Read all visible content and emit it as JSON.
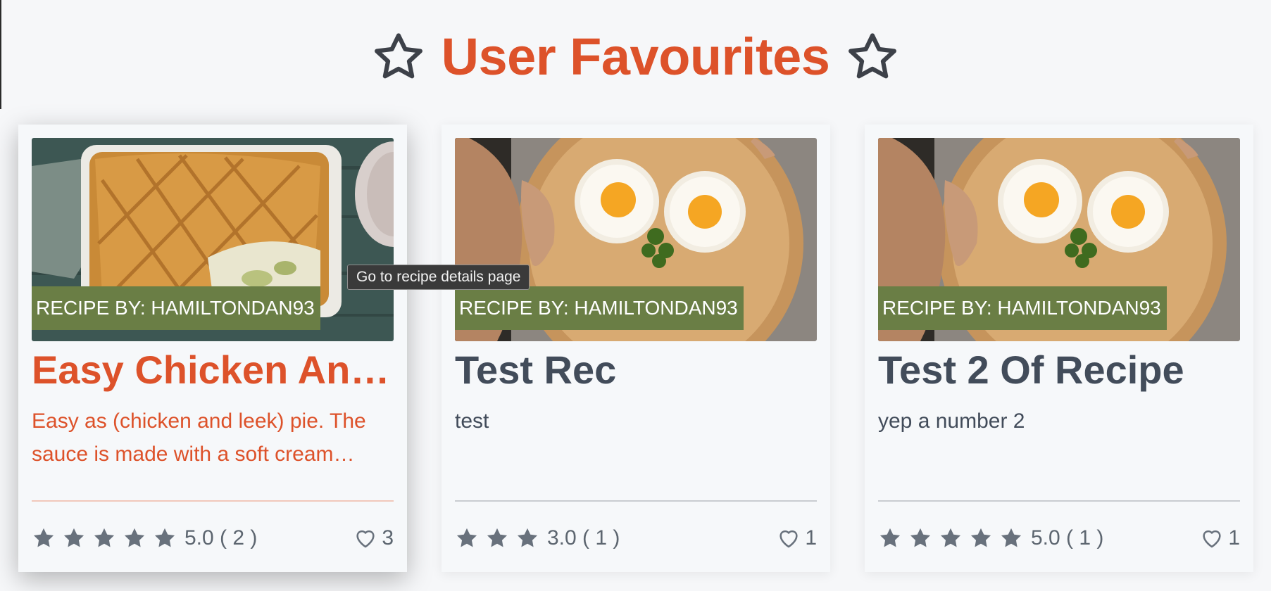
{
  "page": {
    "heading": "User Favourites",
    "accent_color": "#dd522a"
  },
  "tooltip": "Go to recipe details page",
  "recipes": [
    {
      "author_tag": "RECIPE BY: HAMILTONDAN93",
      "title": "Easy Chicken And…",
      "description": "Easy as (chicken and leek) pie. The sauce is made with a soft cream…",
      "stars": 5,
      "rating_label": "5.0 ( 2 )",
      "likes": "3",
      "image": "chicken-leek-pie-photo",
      "hovered": true
    },
    {
      "author_tag": "RECIPE BY: HAMILTONDAN93",
      "title": "Test Rec",
      "description": "test",
      "stars": 3,
      "rating_label": "3.0 ( 1 )",
      "likes": "1",
      "image": "fried-eggs-plate-photo",
      "hovered": false
    },
    {
      "author_tag": "RECIPE BY: HAMILTONDAN93",
      "title": "Test 2 Of Recipe",
      "description": "yep a number 2",
      "stars": 5,
      "rating_label": "5.0 ( 1 )",
      "likes": "1",
      "image": "fried-eggs-plate-photo",
      "hovered": false
    }
  ]
}
